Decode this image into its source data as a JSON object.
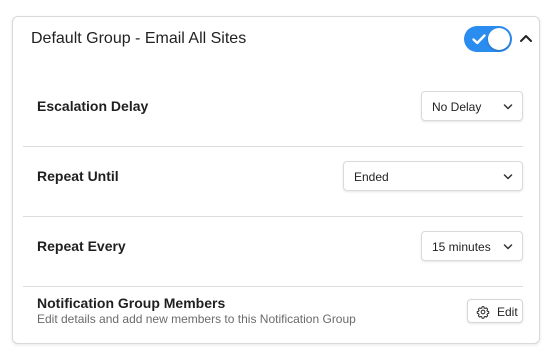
{
  "group": {
    "title": "Default Group - Email All Sites",
    "enabled": true,
    "accent_color": "#2b8cf0"
  },
  "settings": [
    {
      "label": "Escalation Delay",
      "value": "No Delay"
    },
    {
      "label": "Repeat Until",
      "value": "Ended"
    },
    {
      "label": "Repeat Every",
      "value": "15 minutes"
    }
  ],
  "members": {
    "title": "Notification Group Members",
    "description": "Edit details and add new members to this Notification Group",
    "edit_label": "Edit"
  },
  "icons": {
    "toggle": "check-icon",
    "collapse": "chevron-up-icon",
    "select": "chevron-down-icon",
    "edit": "gear-icon"
  }
}
